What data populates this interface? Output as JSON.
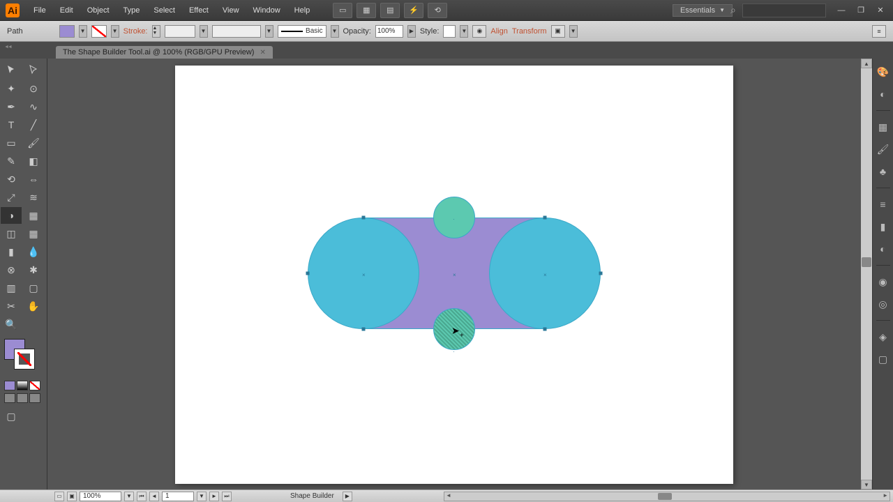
{
  "menubar": {
    "items": [
      "File",
      "Edit",
      "Object",
      "Type",
      "Select",
      "Effect",
      "View",
      "Window",
      "Help"
    ],
    "workspace": "Essentials"
  },
  "controlbar": {
    "selection_label": "Path",
    "stroke_label": "Stroke:",
    "brush_style": "Basic",
    "opacity_label": "Opacity:",
    "opacity_value": "100%",
    "style_label": "Style:",
    "align_label": "Align",
    "transform_label": "Transform"
  },
  "document": {
    "tab_title": "The Shape Builder Tool.ai @ 100% (RGB/GPU Preview)"
  },
  "colors": {
    "fill": "#9b8cd2",
    "circle_blue": "#4bbdd9",
    "circle_green": "#5cc9b0"
  },
  "statusbar": {
    "zoom": "100%",
    "artboard_num": "1",
    "tool": "Shape Builder"
  },
  "right_panels": [
    "color-icon",
    "color-guide-icon",
    "swatches-icon",
    "brushes-icon",
    "symbols-icon",
    "stroke-icon",
    "gradient-icon",
    "transparency-icon",
    "appearance-icon",
    "graphic-styles-icon",
    "layers-icon",
    "artboards-icon"
  ]
}
